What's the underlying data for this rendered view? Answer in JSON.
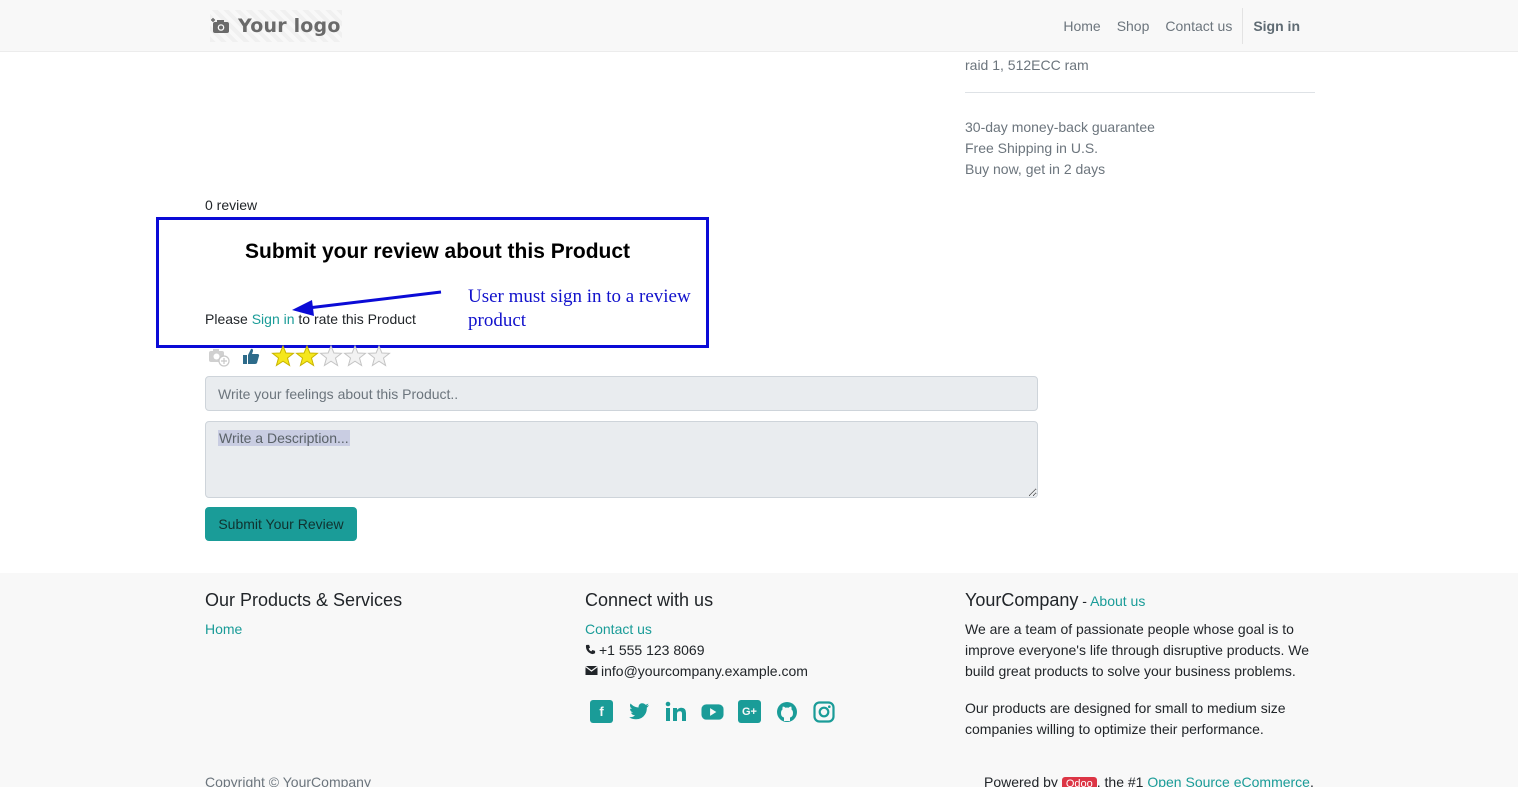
{
  "header": {
    "logo_text": "Your logo",
    "nav": [
      "Home",
      "Shop",
      "Contact us"
    ],
    "signin": "Sign in"
  },
  "product": {
    "spec_line": "raid 1, 512ECC ram",
    "perks": [
      "30-day money-back guarantee",
      "Free Shipping in U.S.",
      "Buy now, get in 2 days"
    ]
  },
  "reviews": {
    "count_label": "0 review",
    "title": "Submit your review about this Product",
    "please": "Please ",
    "signin_link": "Sign in",
    "rate_suffix": " to rate this Product",
    "annotation": "User must sign in to a review product",
    "rating_value": 2,
    "rating_max": 5,
    "title_placeholder": "Write your feelings about this Product..",
    "desc_placeholder": "Write a Description...",
    "submit_label": "Submit Your Review"
  },
  "footer": {
    "col1": {
      "heading": "Our Products & Services",
      "links": [
        "Home"
      ]
    },
    "col2": {
      "heading": "Connect with us",
      "contact_link": "Contact us",
      "phone": "+1 555 123 8069",
      "email": "info@yourcompany.example.com"
    },
    "col3": {
      "heading": "YourCompany",
      "separator": " - ",
      "about_link": "About us",
      "para1": "We are a team of passionate people whose goal is to improve everyone's life through disruptive products. We build great products to solve your business problems.",
      "para2": "Our products are designed for small to medium size companies willing to optimize their performance."
    },
    "social_icons": [
      "facebook-icon",
      "twitter-icon",
      "linkedin-icon",
      "youtube-icon",
      "google-plus-icon",
      "github-icon",
      "instagram-icon"
    ],
    "copyright": "Copyright © YourCompany",
    "powered_prefix": "Powered by ",
    "odoo_badge": "Odoo",
    "powered_mid": ", the #1 ",
    "powered_link": "Open Source eCommerce",
    "powered_suffix": "."
  },
  "colors": {
    "accent": "#1a9c98",
    "annotation_blue": "#0b0bd6",
    "star_filled": "#f5e71c"
  }
}
